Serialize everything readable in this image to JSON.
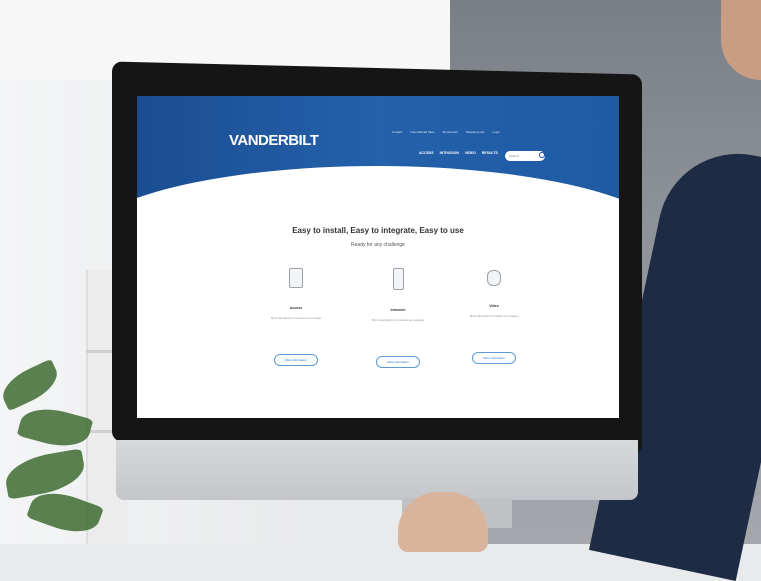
{
  "site": {
    "logo_text": "VANDERBILT",
    "top_links": [
      "Contact",
      "International Sites",
      "My Account",
      "Shopping cart",
      "Login"
    ],
    "nav": [
      "ACCESS",
      "INTRUSION",
      "VIDEO",
      "RESULTS"
    ],
    "search_placeholder": "Search..."
  },
  "content": {
    "headline": "Easy to install, Easy to integrate, Easy to use",
    "subheadline": "Ready for any challenge",
    "columns": [
      {
        "title": "Access",
        "desc": "Short description for Access as a snippet",
        "button": "More Information",
        "icon": "access-panel-icon"
      },
      {
        "title": "Intrusion",
        "desc": "Short description for Intrusion as a snippet",
        "button": "More Information",
        "icon": "phone-device-icon"
      },
      {
        "title": "Video",
        "desc": "Short description for Video as a snippet",
        "button": "More Information",
        "icon": "camera-icon"
      }
    ]
  },
  "colors": {
    "brand_blue": "#1f5aa3"
  }
}
